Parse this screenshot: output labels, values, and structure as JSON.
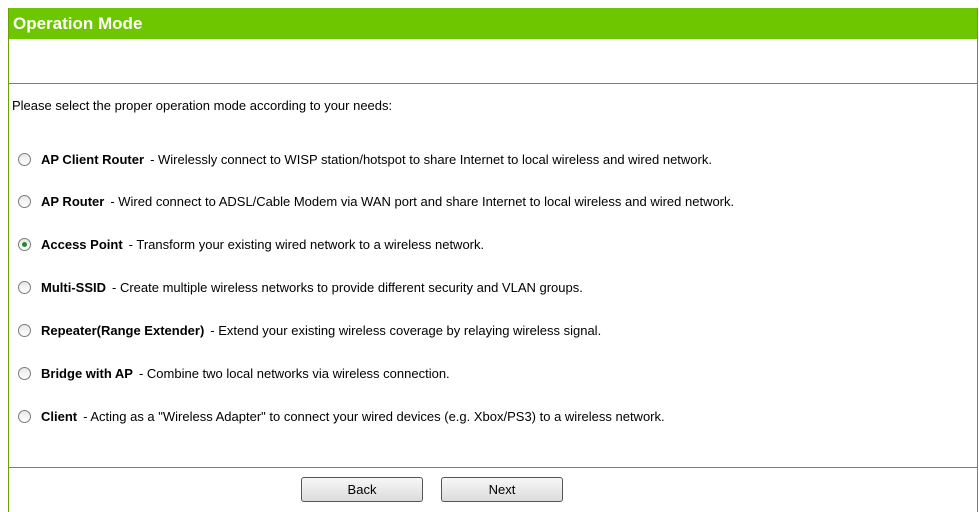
{
  "header": {
    "title": "Operation Mode"
  },
  "instruction": "Please select the proper operation mode according to your needs:",
  "modes": [
    {
      "name": "AP Client Router",
      "description": "- Wirelessly connect to WISP station/hotspot to share Internet to local wireless and wired network.",
      "selected": false
    },
    {
      "name": "AP Router",
      "description": "- Wired connect to ADSL/Cable Modem via WAN port and share Internet to local wireless and wired network.",
      "selected": false
    },
    {
      "name": "Access Point",
      "description": "- Transform your existing wired network to a wireless network.",
      "selected": true
    },
    {
      "name": "Multi-SSID",
      "description": "- Create multiple wireless networks to provide different security and VLAN groups.",
      "selected": false
    },
    {
      "name": "Repeater(Range Extender)",
      "description": "- Extend your existing wireless coverage by relaying wireless signal.",
      "selected": false
    },
    {
      "name": "Bridge with AP",
      "description": "- Combine two local networks via wireless connection.",
      "selected": false
    },
    {
      "name": "Client",
      "description": "- Acting as a \"Wireless Adapter\" to connect your wired devices (e.g. Xbox/PS3) to a wireless network.",
      "selected": false
    }
  ],
  "buttons": {
    "back_label": "Back",
    "next_label": "Next"
  },
  "colors": {
    "header_background": "#6dc600",
    "border": "#66a300",
    "radio_selected_dot": "#1f8a2c"
  },
  "icons": {
    "radio_unselected": "radio-button-unselected-icon",
    "radio_selected": "radio-button-selected-icon"
  }
}
